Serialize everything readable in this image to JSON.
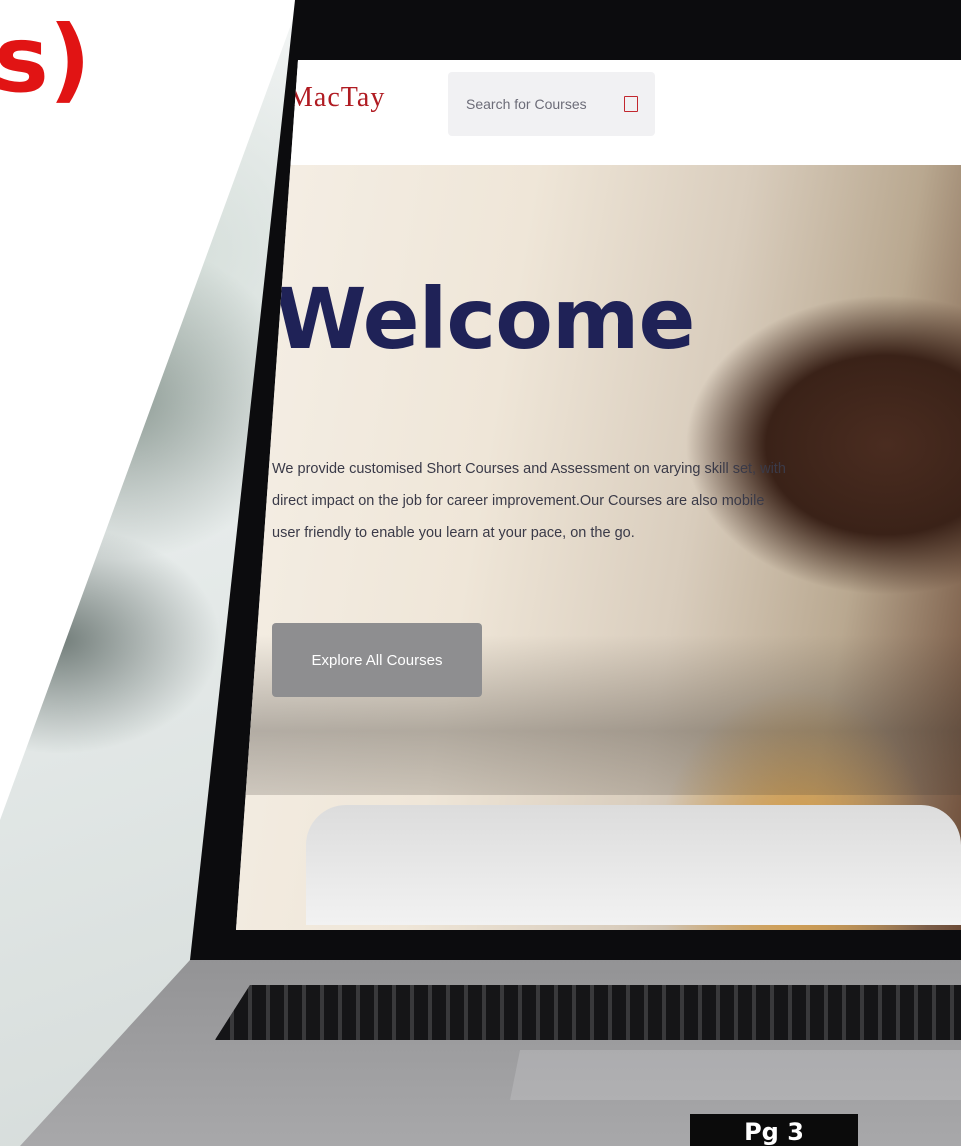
{
  "corner_text": "s)",
  "header": {
    "logo": "MacTay",
    "search": {
      "placeholder": "Search for Courses"
    }
  },
  "hero": {
    "title": "Welcome",
    "description_lines": [
      "We provide customised Short Courses and Assessment on varying skill set, with",
      "direct impact on the job for career improvement.Our Courses are also mobile",
      "user friendly to enable you learn at your pace, on the go."
    ],
    "cta_label": "Explore All Courses"
  },
  "page_tag": "Pg 3",
  "colors": {
    "logo": "#b01b22",
    "title": "#1f2257",
    "cta_bg": "#8e8e90",
    "corner_text": "#e11414"
  },
  "icons": {
    "search": "search-icon"
  }
}
